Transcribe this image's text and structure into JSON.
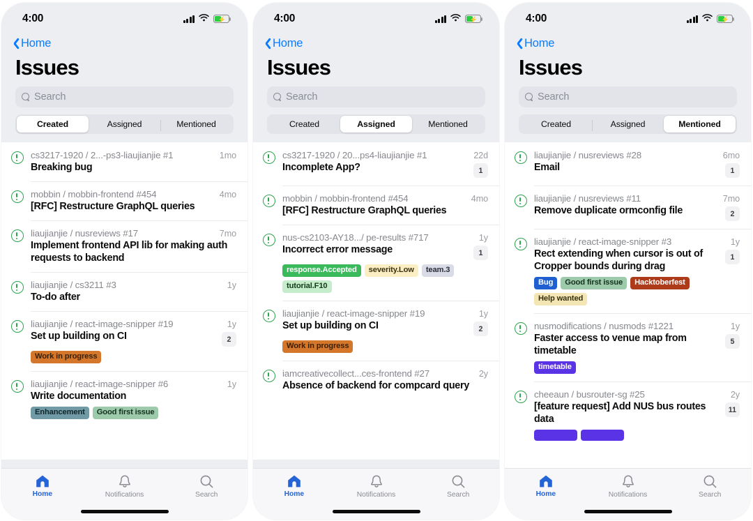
{
  "statusbar": {
    "time": "4:00",
    "signal_icon": "cellular-signal-icon",
    "wifi_icon": "wifi-icon",
    "battery_icon": "battery-charging-icon"
  },
  "nav": {
    "back_label": "Home"
  },
  "page": {
    "title": "Issues"
  },
  "search": {
    "placeholder": "Search",
    "icon": "search-icon"
  },
  "segments": [
    "Created",
    "Assigned",
    "Mentioned"
  ],
  "tabbar": {
    "items": [
      {
        "label": "Home",
        "icon": "home-icon"
      },
      {
        "label": "Notifications",
        "icon": "bell-icon"
      },
      {
        "label": "Search",
        "icon": "search-icon"
      }
    ]
  },
  "label_colors": {
    "work_in_progress": {
      "bg": "#d4772a",
      "fg": "#3a1f05"
    },
    "enhancement": {
      "bg": "#6f9aa6",
      "fg": "#12262b"
    },
    "good_first_issue": {
      "bg": "#9ccaab",
      "fg": "#16321f"
    },
    "response_accepted": {
      "bg": "#3bba5b",
      "fg": "#ffffff"
    },
    "severity_low": {
      "bg": "#fbeec2",
      "fg": "#3a3112"
    },
    "team_3": {
      "bg": "#d9dbe6",
      "fg": "#2b2d38"
    },
    "tutorial_f10": {
      "bg": "#c6edcb",
      "fg": "#153a1b"
    },
    "bug": {
      "bg": "#1f5fd0",
      "fg": "#ffffff"
    },
    "hacktoberfest": {
      "bg": "#ad3a18",
      "fg": "#ffffff"
    },
    "help_wanted": {
      "bg": "#f3e5b4",
      "fg": "#38310f"
    },
    "timetable": {
      "bg": "#5b33e6",
      "fg": "#ffffff"
    },
    "purple_cut_a": {
      "bg": "#5b33e6",
      "fg": "#ffffff"
    },
    "purple_cut_b": {
      "bg": "#5b33e6",
      "fg": "#ffffff"
    }
  },
  "accent": {
    "link": "#0a7cff",
    "tab_active": "#2464d6",
    "issue_open": "#2da44e"
  },
  "panels": [
    {
      "active_segment": "Created",
      "issues": [
        {
          "repo": "cs3217-1920 / 2...-ps3-liaujianjie #1",
          "age": "1mo",
          "title": "Breaking bug",
          "comments": null,
          "labels": []
        },
        {
          "repo": "mobbin / mobbin-frontend #454",
          "age": "4mo",
          "title": "[RFC] Restructure GraphQL queries",
          "comments": null,
          "labels": []
        },
        {
          "repo": "liaujianjie / nusreviews #17",
          "age": "7mo",
          "title": "Implement frontend API lib for making auth requests to backend",
          "comments": null,
          "labels": []
        },
        {
          "repo": "liaujianjie / cs3211 #3",
          "age": "1y",
          "title": "To-do after",
          "comments": null,
          "labels": []
        },
        {
          "repo": "liaujianjie / react-image-snipper #19",
          "age": "1y",
          "title": "Set up building on CI",
          "comments": "2",
          "labels": [
            {
              "text": "Work in progress",
              "color": "work_in_progress"
            }
          ]
        },
        {
          "repo": "liaujianjie / react-image-snipper #6",
          "age": "1y",
          "title": "Write documentation",
          "comments": null,
          "labels": [
            {
              "text": "Enhancement",
              "color": "enhancement"
            },
            {
              "text": "Good first issue",
              "color": "good_first_issue"
            }
          ]
        }
      ]
    },
    {
      "active_segment": "Assigned",
      "issues": [
        {
          "repo": "cs3217-1920 / 20...ps4-liaujianjie #1",
          "age": "22d",
          "title": "Incomplete App?",
          "comments": "1",
          "labels": []
        },
        {
          "repo": "mobbin / mobbin-frontend #454",
          "age": "4mo",
          "title": "[RFC] Restructure GraphQL queries",
          "comments": null,
          "labels": []
        },
        {
          "repo": "nus-cs2103-AY18.../ pe-results #717",
          "age": "1y",
          "title": "Incorrect error message",
          "comments": "1",
          "labels": [
            {
              "text": "response.Accepted",
              "color": "response_accepted"
            },
            {
              "text": "severity.Low",
              "color": "severity_low"
            },
            {
              "text": "team.3",
              "color": "team_3"
            },
            {
              "text": "tutorial.F10",
              "color": "tutorial_f10"
            }
          ]
        },
        {
          "repo": "liaujianjie / react-image-snipper #19",
          "age": "1y",
          "title": "Set up building on CI",
          "comments": "2",
          "labels": [
            {
              "text": "Work in progress",
              "color": "work_in_progress"
            }
          ]
        },
        {
          "repo": "iamcreativecollect...ces-frontend #27",
          "age": "2y",
          "title": "Absence of backend for compcard query",
          "comments": null,
          "labels": []
        }
      ]
    },
    {
      "active_segment": "Mentioned",
      "issues": [
        {
          "repo": "liaujianjie / nusreviews #28",
          "age": "6mo",
          "title": "Email",
          "comments": "1",
          "labels": []
        },
        {
          "repo": "liaujianjie / nusreviews #11",
          "age": "7mo",
          "title": "Remove duplicate ormconfig file",
          "comments": "2",
          "labels": []
        },
        {
          "repo": "liaujianjie / react-image-snipper #3",
          "age": "1y",
          "title": "Rect extending when cursor is out of Cropper bounds during drag",
          "comments": "1",
          "labels": [
            {
              "text": "Bug",
              "color": "bug"
            },
            {
              "text": "Good first issue",
              "color": "good_first_issue"
            },
            {
              "text": "Hacktoberfest",
              "color": "hacktoberfest"
            },
            {
              "text": "Help wanted",
              "color": "help_wanted"
            }
          ]
        },
        {
          "repo": "nusmodifications / nusmods #1221",
          "age": "1y",
          "title": "Faster access to venue map from timetable",
          "comments": "5",
          "labels": [
            {
              "text": "timetable",
              "color": "timetable"
            }
          ]
        },
        {
          "repo": "cheeaun / busrouter-sg #25",
          "age": "2y",
          "title": "[feature request] Add NUS bus routes data",
          "comments": "11",
          "labels": [
            {
              "text": "",
              "color": "purple_cut_a"
            },
            {
              "text": "",
              "color": "purple_cut_b"
            }
          ]
        }
      ]
    }
  ]
}
